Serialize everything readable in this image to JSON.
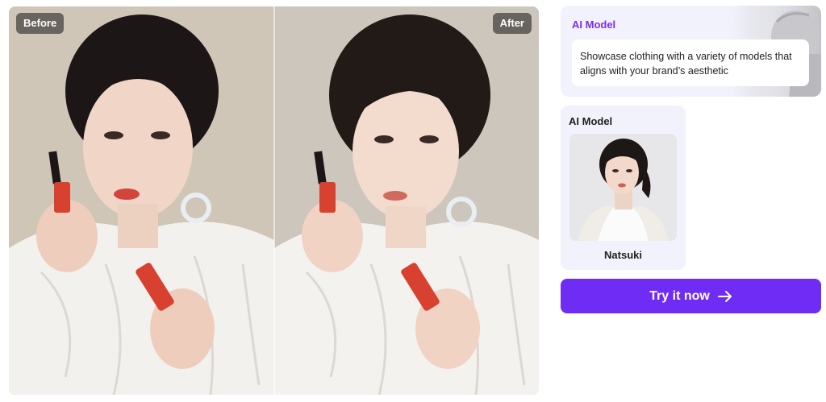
{
  "comparison": {
    "before_label": "Before",
    "after_label": "After"
  },
  "info_card": {
    "title": "AI Model",
    "description": "Showcase clothing with a variety of models that aligns with your brand’s aesthetic",
    "accent_color": "#7b2cf0"
  },
  "model_card": {
    "title": "AI Model",
    "model_name": "Natsuki"
  },
  "cta": {
    "label": "Try it now",
    "icon": "arrow-right-icon",
    "color": "#6f2cf5"
  }
}
